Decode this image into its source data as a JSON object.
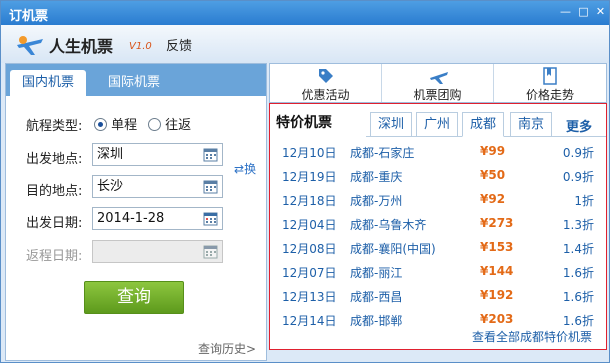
{
  "window": {
    "title": "订机票",
    "min": "—",
    "max": "□",
    "close": "✕"
  },
  "header": {
    "app_name": "人生机票",
    "version": "V1.0",
    "feedback": "反馈"
  },
  "left_tabs": [
    "国内机票",
    "国际机票"
  ],
  "form": {
    "trip_type_label": "航程类型:",
    "one_way": "单程",
    "round_trip": "往返",
    "from_label": "出发地点:",
    "from_value": "深圳",
    "to_label": "目的地点:",
    "to_value": "长沙",
    "depart_label": "出发日期:",
    "depart_value": "2014-1-28",
    "return_label": "返程日期:",
    "return_value": "",
    "swap": "换",
    "query": "查询",
    "history": "查询历史>"
  },
  "right_tabs": [
    "优惠活动",
    "机票团购",
    "价格走势"
  ],
  "special": {
    "title": "特价机票",
    "cities": [
      "深圳",
      "广州",
      "成都",
      "南京"
    ],
    "active_city": "成都",
    "more": "更多",
    "view_all": "查看全部成都特价机票",
    "flights": [
      {
        "date": "12月10日",
        "route": "成都-石家庄",
        "price": "¥99",
        "discount": "0.9折"
      },
      {
        "date": "12月19日",
        "route": "成都-重庆",
        "price": "¥50",
        "discount": "0.9折"
      },
      {
        "date": "12月18日",
        "route": "成都-万州",
        "price": "¥92",
        "discount": "1折"
      },
      {
        "date": "12月04日",
        "route": "成都-乌鲁木齐",
        "price": "¥273",
        "discount": "1.3折"
      },
      {
        "date": "12月08日",
        "route": "成都-襄阳(中国)",
        "price": "¥153",
        "discount": "1.4折"
      },
      {
        "date": "12月07日",
        "route": "成都-丽江",
        "price": "¥144",
        "discount": "1.6折"
      },
      {
        "date": "12月13日",
        "route": "成都-西昌",
        "price": "¥192",
        "discount": "1.6折"
      },
      {
        "date": "12月14日",
        "route": "成都-邯郸",
        "price": "¥203",
        "discount": "1.6折"
      }
    ]
  },
  "colors": {
    "accent": "#2a7cd0",
    "price": "#e36a17",
    "highlight_border": "#e0202f",
    "button": "#6aa62a"
  }
}
